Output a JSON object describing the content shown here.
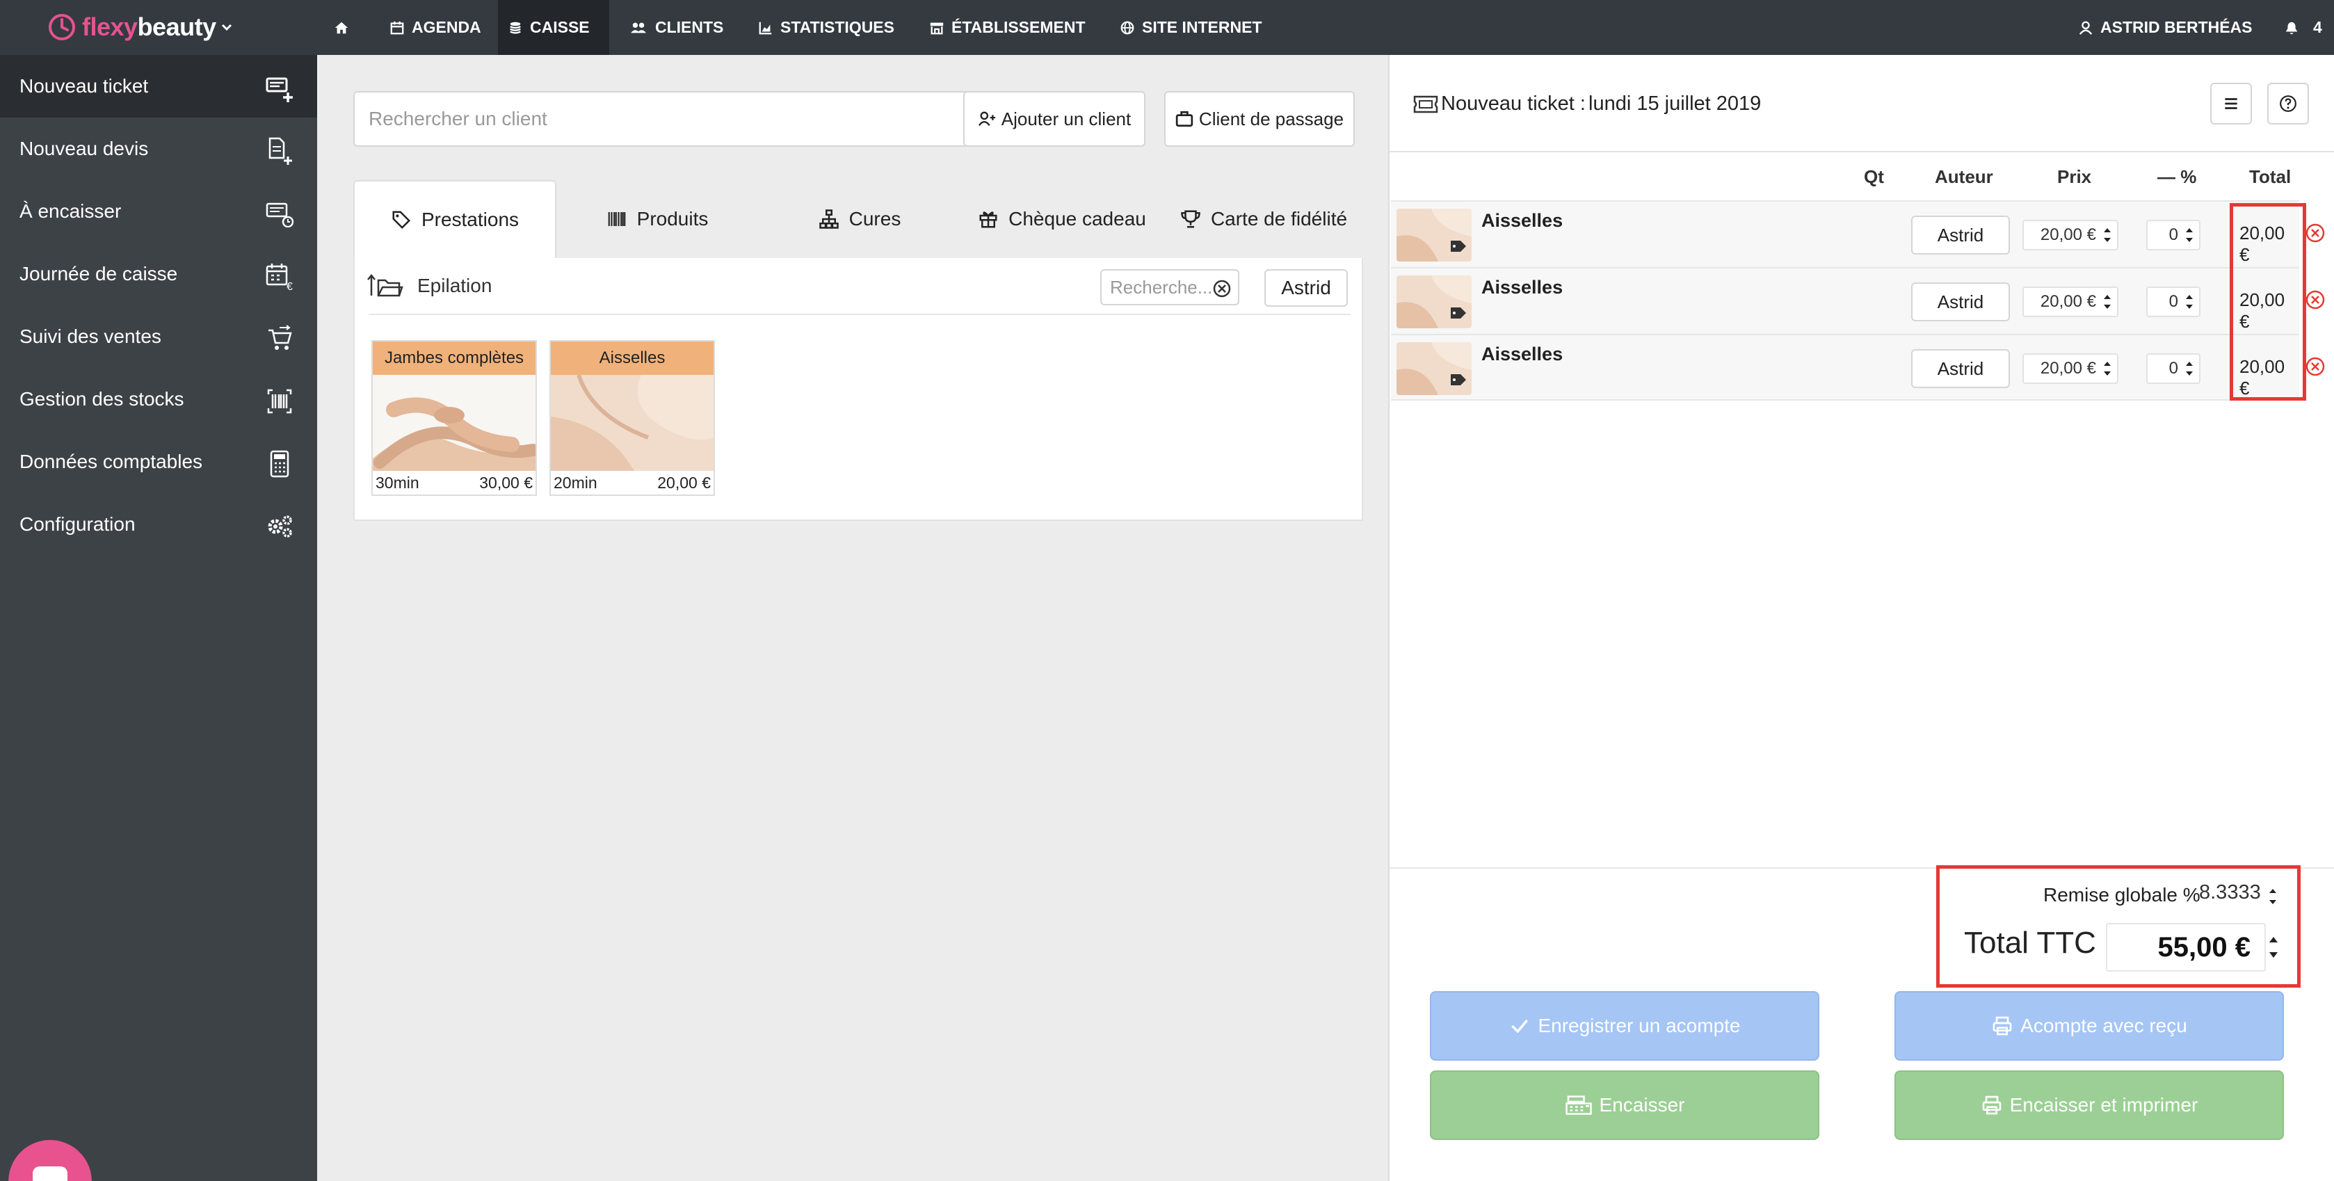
{
  "app": {
    "logo_flexy": "flexy",
    "logo_beauty": "beauty"
  },
  "topnav": {
    "home": "home",
    "agenda": "AGENDA",
    "caisse": "CAISSE",
    "clients": "CLIENTS",
    "statistiques": "STATISTIQUES",
    "etablissement": "ÉTABLISSEMENT",
    "site_internet": "SITE INTERNET",
    "user": "ASTRID BERTHÉAS",
    "notif_count": "4"
  },
  "sidebar": {
    "items": [
      {
        "label": "Nouveau ticket",
        "icon": "ticket-add-icon"
      },
      {
        "label": "Nouveau devis",
        "icon": "quote-add-icon"
      },
      {
        "label": "À encaisser",
        "icon": "pending-payment-icon"
      },
      {
        "label": "Journée de caisse",
        "icon": "calendar-cash-icon"
      },
      {
        "label": "Suivi des ventes",
        "icon": "cart-icon"
      },
      {
        "label": "Gestion des stocks",
        "icon": "barcode-icon"
      },
      {
        "label": "Données comptables",
        "icon": "calculator-icon"
      },
      {
        "label": "Configuration",
        "icon": "gears-icon"
      }
    ]
  },
  "client_bar": {
    "search_placeholder": "Rechercher un client",
    "add_client": "Ajouter un client",
    "walk_in": "Client de passage"
  },
  "tabs": [
    {
      "label": "Prestations",
      "icon": "tag-icon"
    },
    {
      "label": "Produits",
      "icon": "barcode-icon"
    },
    {
      "label": "Cures",
      "icon": "sitemap-icon"
    },
    {
      "label": "Chèque cadeau",
      "icon": "gift-icon"
    },
    {
      "label": "Carte de fidélité",
      "icon": "trophy-icon"
    }
  ],
  "catalog": {
    "folder": "Epilation",
    "search_placeholder": "Recherche...",
    "author": "Astrid",
    "items": [
      {
        "name": "Jambes complètes",
        "duration": "30min",
        "price": "30,00 €"
      },
      {
        "name": "Aisselles",
        "duration": "20min",
        "price": "20,00 €"
      }
    ]
  },
  "ticket": {
    "title": "Nouveau ticket :",
    "date": "lundi 15 juillet 2019",
    "columns": {
      "qt": "Qt",
      "author": "Auteur",
      "price": "Prix",
      "discount": "— %",
      "total": "Total"
    },
    "lines": [
      {
        "name": "Aisselles",
        "author": "Astrid",
        "price": "20,00 €",
        "discount": "0",
        "total": "20,00 €"
      },
      {
        "name": "Aisselles",
        "author": "Astrid",
        "price": "20,00 €",
        "discount": "0",
        "total": "20,00 €"
      },
      {
        "name": "Aisselles",
        "author": "Astrid",
        "price": "20,00 €",
        "discount": "0",
        "total": "20,00 €"
      }
    ],
    "global_discount_label": "Remise globale %",
    "global_discount_value": "8.3333",
    "total_label": "Total TTC",
    "total_value": "55,00 €"
  },
  "actions": {
    "deposit": "Enregistrer un acompte",
    "deposit_receipt": "Acompte avec reçu",
    "checkout": "Encaisser",
    "checkout_print": "Encaisser et imprimer"
  },
  "colors": {
    "brand": "#e7528f",
    "topbar": "#343a40",
    "sidebar": "#3d4247",
    "highlight": "#e53935",
    "btn_blue": "#a5c5f5",
    "btn_green": "#9ccf95"
  }
}
